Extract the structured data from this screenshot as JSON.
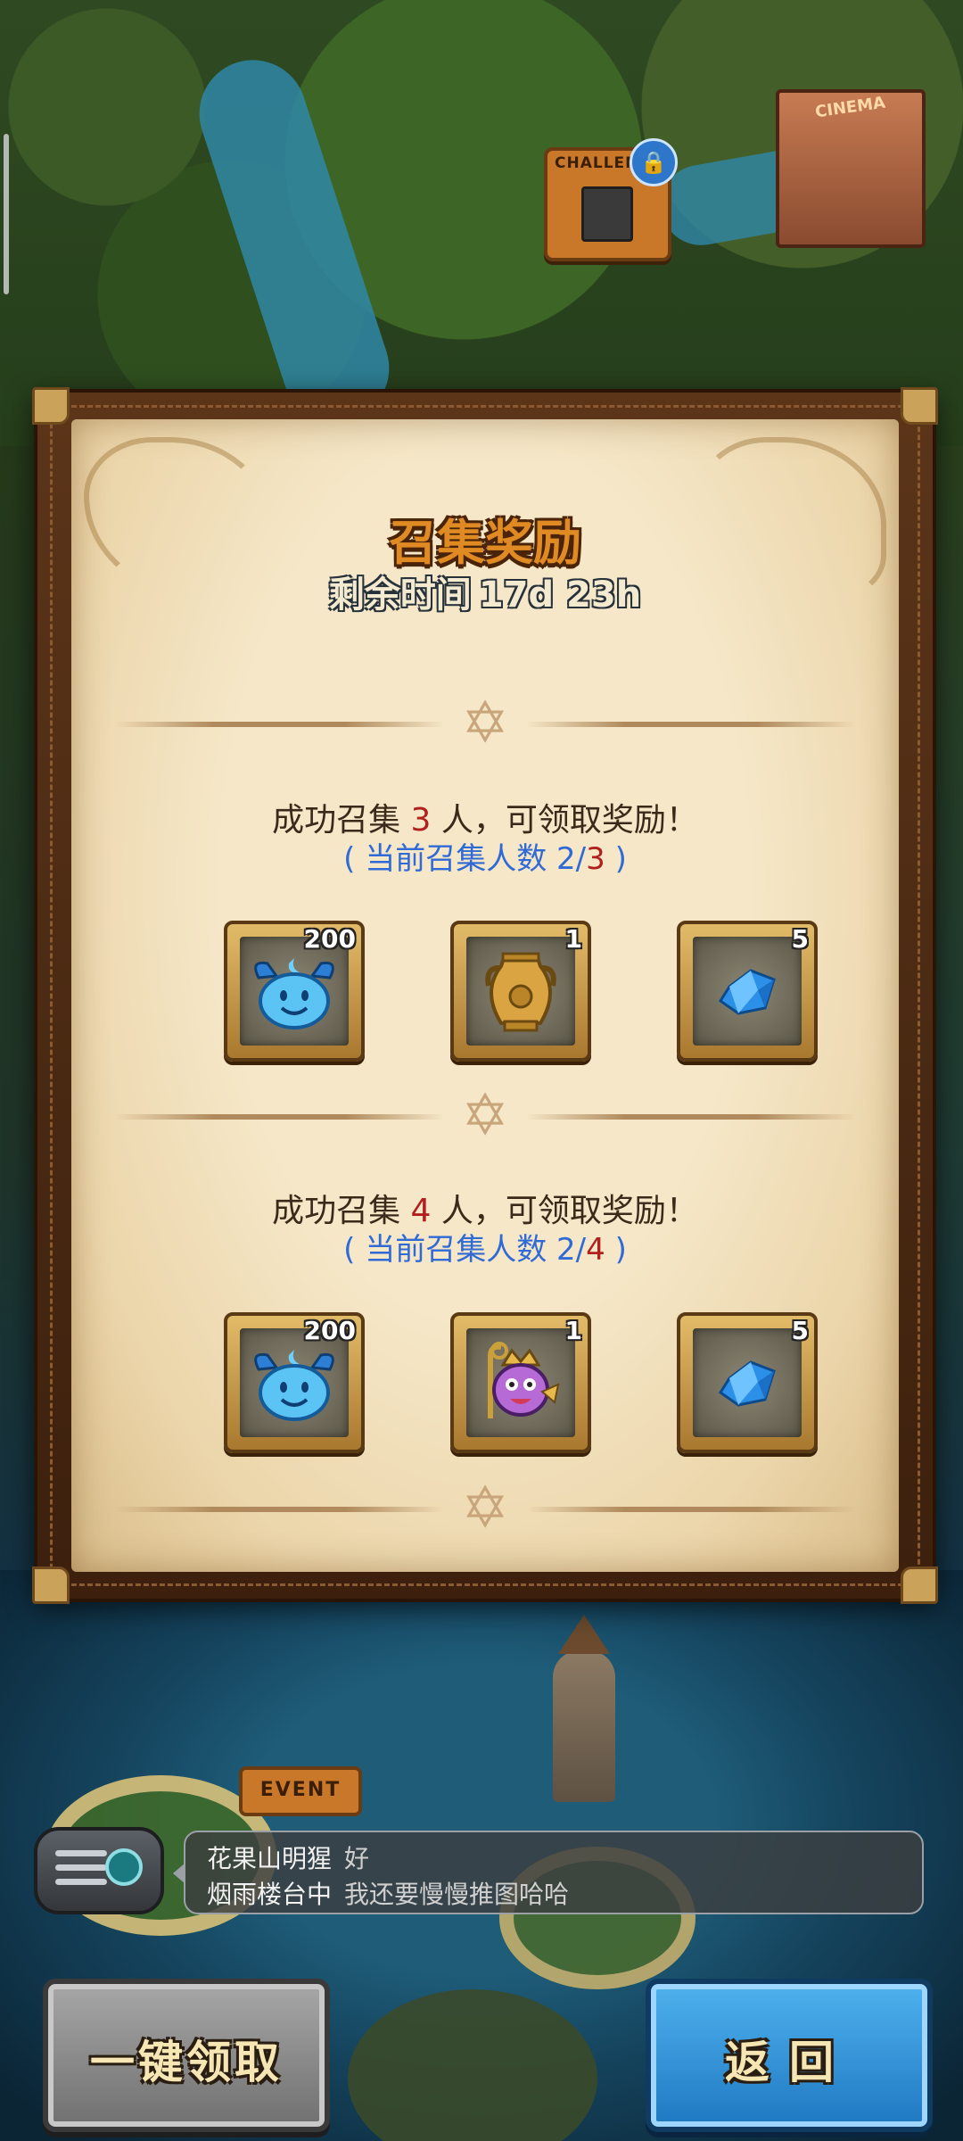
{
  "map": {
    "challenge_sign": "CHALLENGE",
    "cinema_sign": "CINEMA",
    "event_sign": "EVENT"
  },
  "dialog": {
    "title": "召集奖励",
    "timer_label": "剩余时间",
    "timer_value": "17d 23h",
    "tiers": [
      {
        "req_prefix": "成功召集",
        "req_count": "3",
        "req_suffix": "人，可领取奖励！",
        "progress_prefix": "( 当前召集人数",
        "progress_current": "2",
        "progress_sep": "/",
        "progress_target": "3",
        "progress_suffix": ")",
        "rewards": [
          {
            "icon": "blue-slime-icon",
            "qty": "200"
          },
          {
            "icon": "golden-urn-icon",
            "qty": "1"
          },
          {
            "icon": "blue-crystal-icon",
            "qty": "5"
          }
        ]
      },
      {
        "req_prefix": "成功召集",
        "req_count": "4",
        "req_suffix": "人，可领取奖励！",
        "progress_prefix": "( 当前召集人数",
        "progress_current": "2",
        "progress_sep": "/",
        "progress_target": "4",
        "progress_suffix": ")",
        "rewards": [
          {
            "icon": "blue-slime-icon",
            "qty": "200"
          },
          {
            "icon": "purple-hero-icon",
            "qty": "1"
          },
          {
            "icon": "blue-crystal-icon",
            "qty": "5"
          }
        ]
      }
    ]
  },
  "chat": {
    "messages": [
      {
        "sender": "花果山明猩",
        "text": "好"
      },
      {
        "sender": "烟雨楼台中",
        "text": "我还要慢慢推图哈哈"
      }
    ]
  },
  "buttons": {
    "claim_all": "一键领取",
    "back": "返回"
  },
  "colors": {
    "title": "#e08a24",
    "highlight_number": "#b0211e",
    "progress_text": "#2f6ad6",
    "back_button": "#2f8fd6",
    "claim_button": "#8c8c8c"
  }
}
